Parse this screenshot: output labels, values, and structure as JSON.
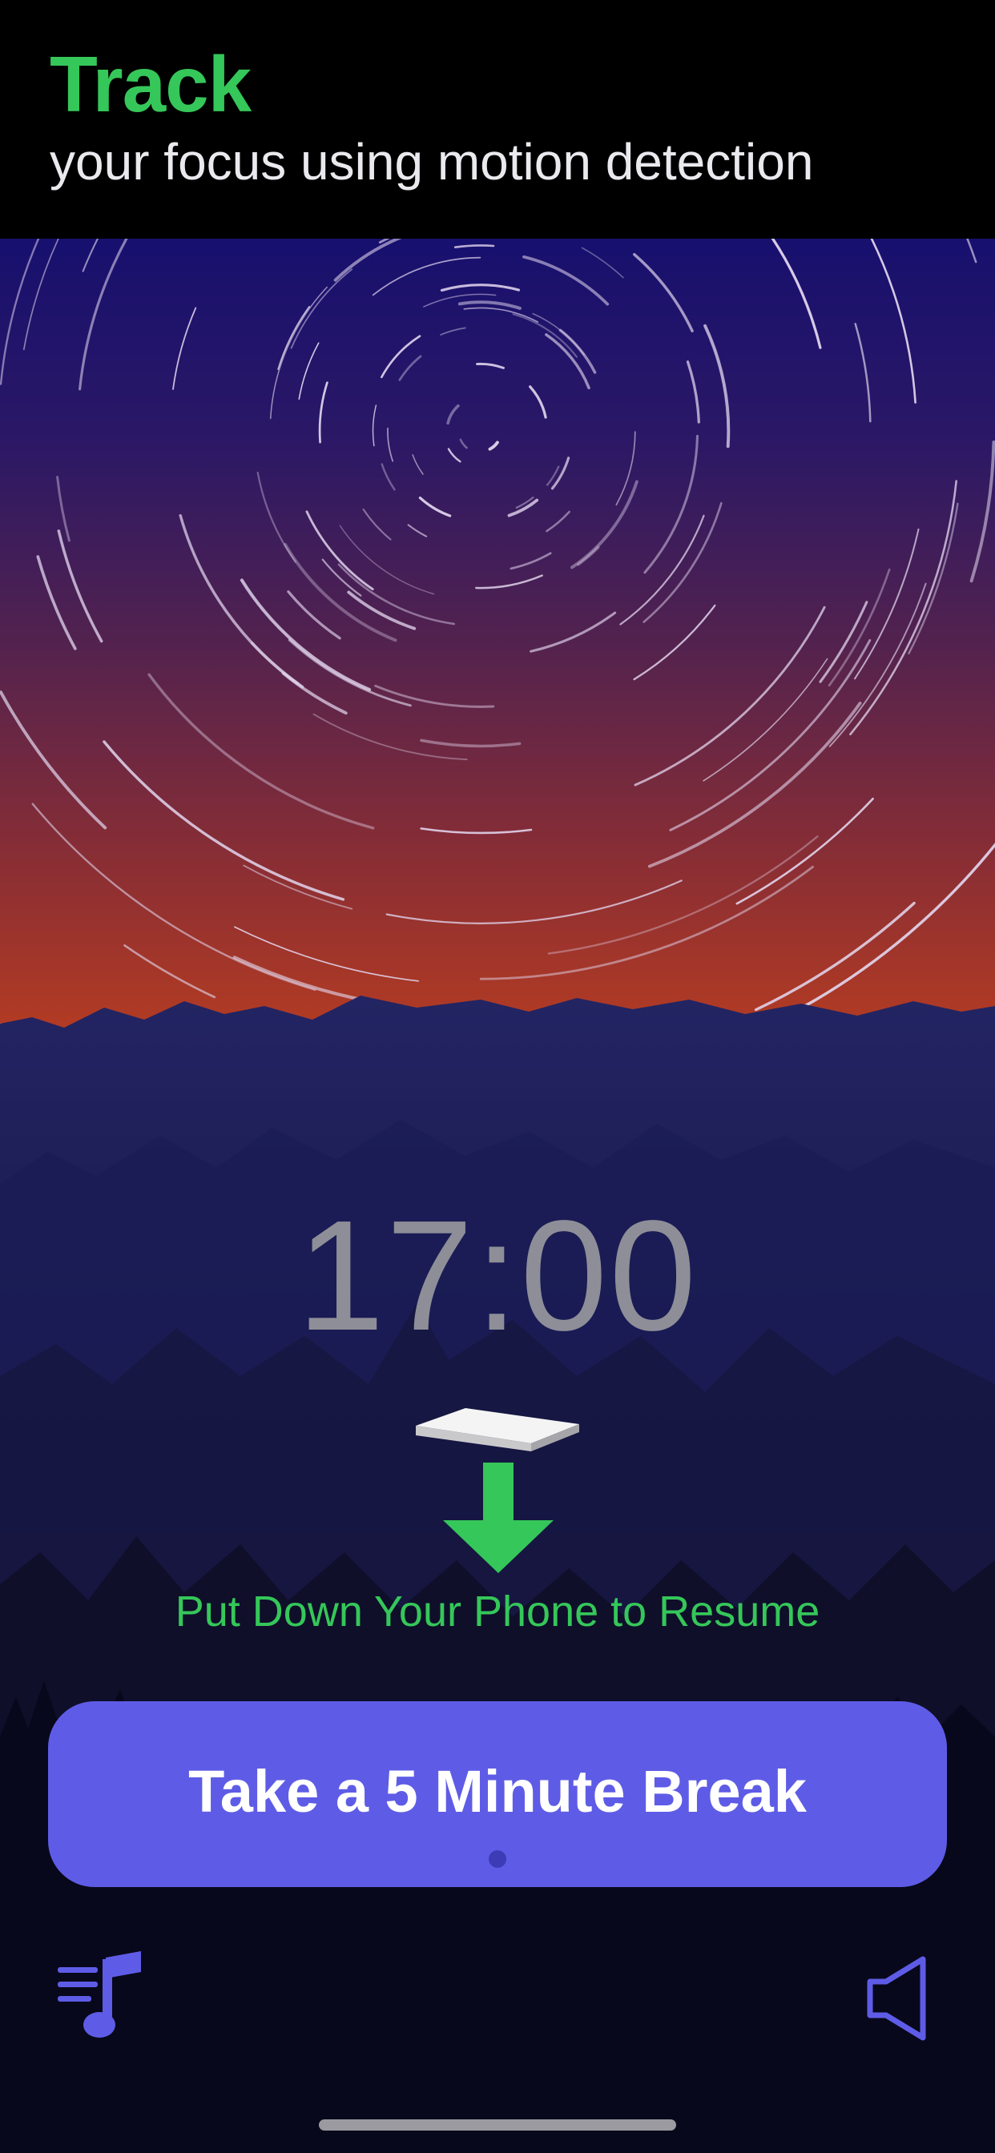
{
  "header": {
    "title": "Track",
    "subtitle": "your focus using motion detection"
  },
  "timer": {
    "display": "17:00"
  },
  "hint": {
    "text": "Put Down Your Phone to Resume"
  },
  "break_button": {
    "label": "Take a 5 Minute Break"
  },
  "toolbar": {
    "left_icon": "music-playlist-icon",
    "right_icon": "speaker-icon"
  },
  "colors": {
    "accent_green": "#35c759",
    "accent_purple": "#5e5ce6",
    "timer_gray": "#8e8e98",
    "header_background": "#000000",
    "sky_top": "#1a1470",
    "sky_horizon": "#b03a22"
  }
}
